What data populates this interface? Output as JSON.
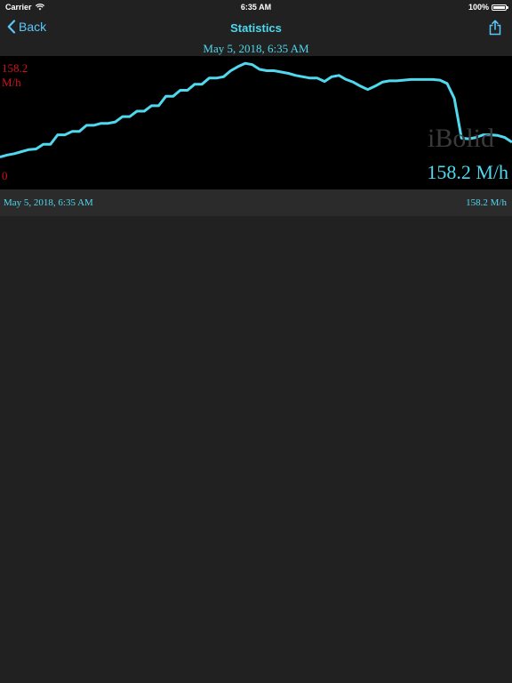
{
  "status_bar": {
    "carrier": "Carrier",
    "time": "6:35 AM",
    "battery": "100%"
  },
  "nav": {
    "back_label": "Back",
    "title": "Statistics"
  },
  "date_header": "May 5, 2018, 6:35 AM",
  "chart": {
    "y_max_value": "158.2",
    "y_max_unit": "M/h",
    "y_min_label": "0",
    "watermark": "iBolid",
    "current_value": "158.2 M/h",
    "line_color": "#4fd8ee",
    "label_color": "#d0121b"
  },
  "chart_data": {
    "type": "line",
    "y_range": [
      0,
      158.2
    ],
    "y_unit": "M/h",
    "x": [
      0,
      1,
      2,
      3,
      4,
      5,
      6,
      7,
      8,
      9,
      10,
      11,
      12,
      13,
      14,
      15,
      16,
      17,
      18,
      19,
      20,
      21,
      22,
      23,
      24,
      25,
      26,
      27,
      28,
      29,
      30,
      31,
      32,
      33,
      34,
      35,
      36,
      37,
      38,
      39,
      40,
      41,
      42,
      43,
      44,
      45,
      46,
      47,
      48,
      49,
      50,
      51,
      52,
      53,
      54,
      55,
      56,
      57,
      58,
      59,
      60,
      61,
      62,
      63,
      64,
      65,
      66,
      67,
      68,
      69,
      70,
      71
    ],
    "values": [
      19,
      22,
      24,
      27,
      30,
      31,
      38,
      38,
      52,
      52,
      57,
      57,
      66,
      66,
      69,
      69,
      71,
      79,
      79,
      87,
      87,
      95,
      95,
      109,
      109,
      118,
      118,
      127,
      127,
      136,
      136,
      138,
      147,
      153,
      158,
      156,
      149,
      147,
      147,
      145,
      143,
      140,
      138,
      136,
      136,
      131,
      138,
      140,
      134,
      130,
      124,
      119,
      124,
      130,
      132,
      132,
      133,
      134,
      134,
      134,
      134,
      133,
      128,
      106,
      47,
      46,
      48,
      52,
      52,
      51,
      48,
      41
    ]
  },
  "record": {
    "date": "May 5, 2018, 6:35 AM",
    "value": "158.2 M/h"
  }
}
